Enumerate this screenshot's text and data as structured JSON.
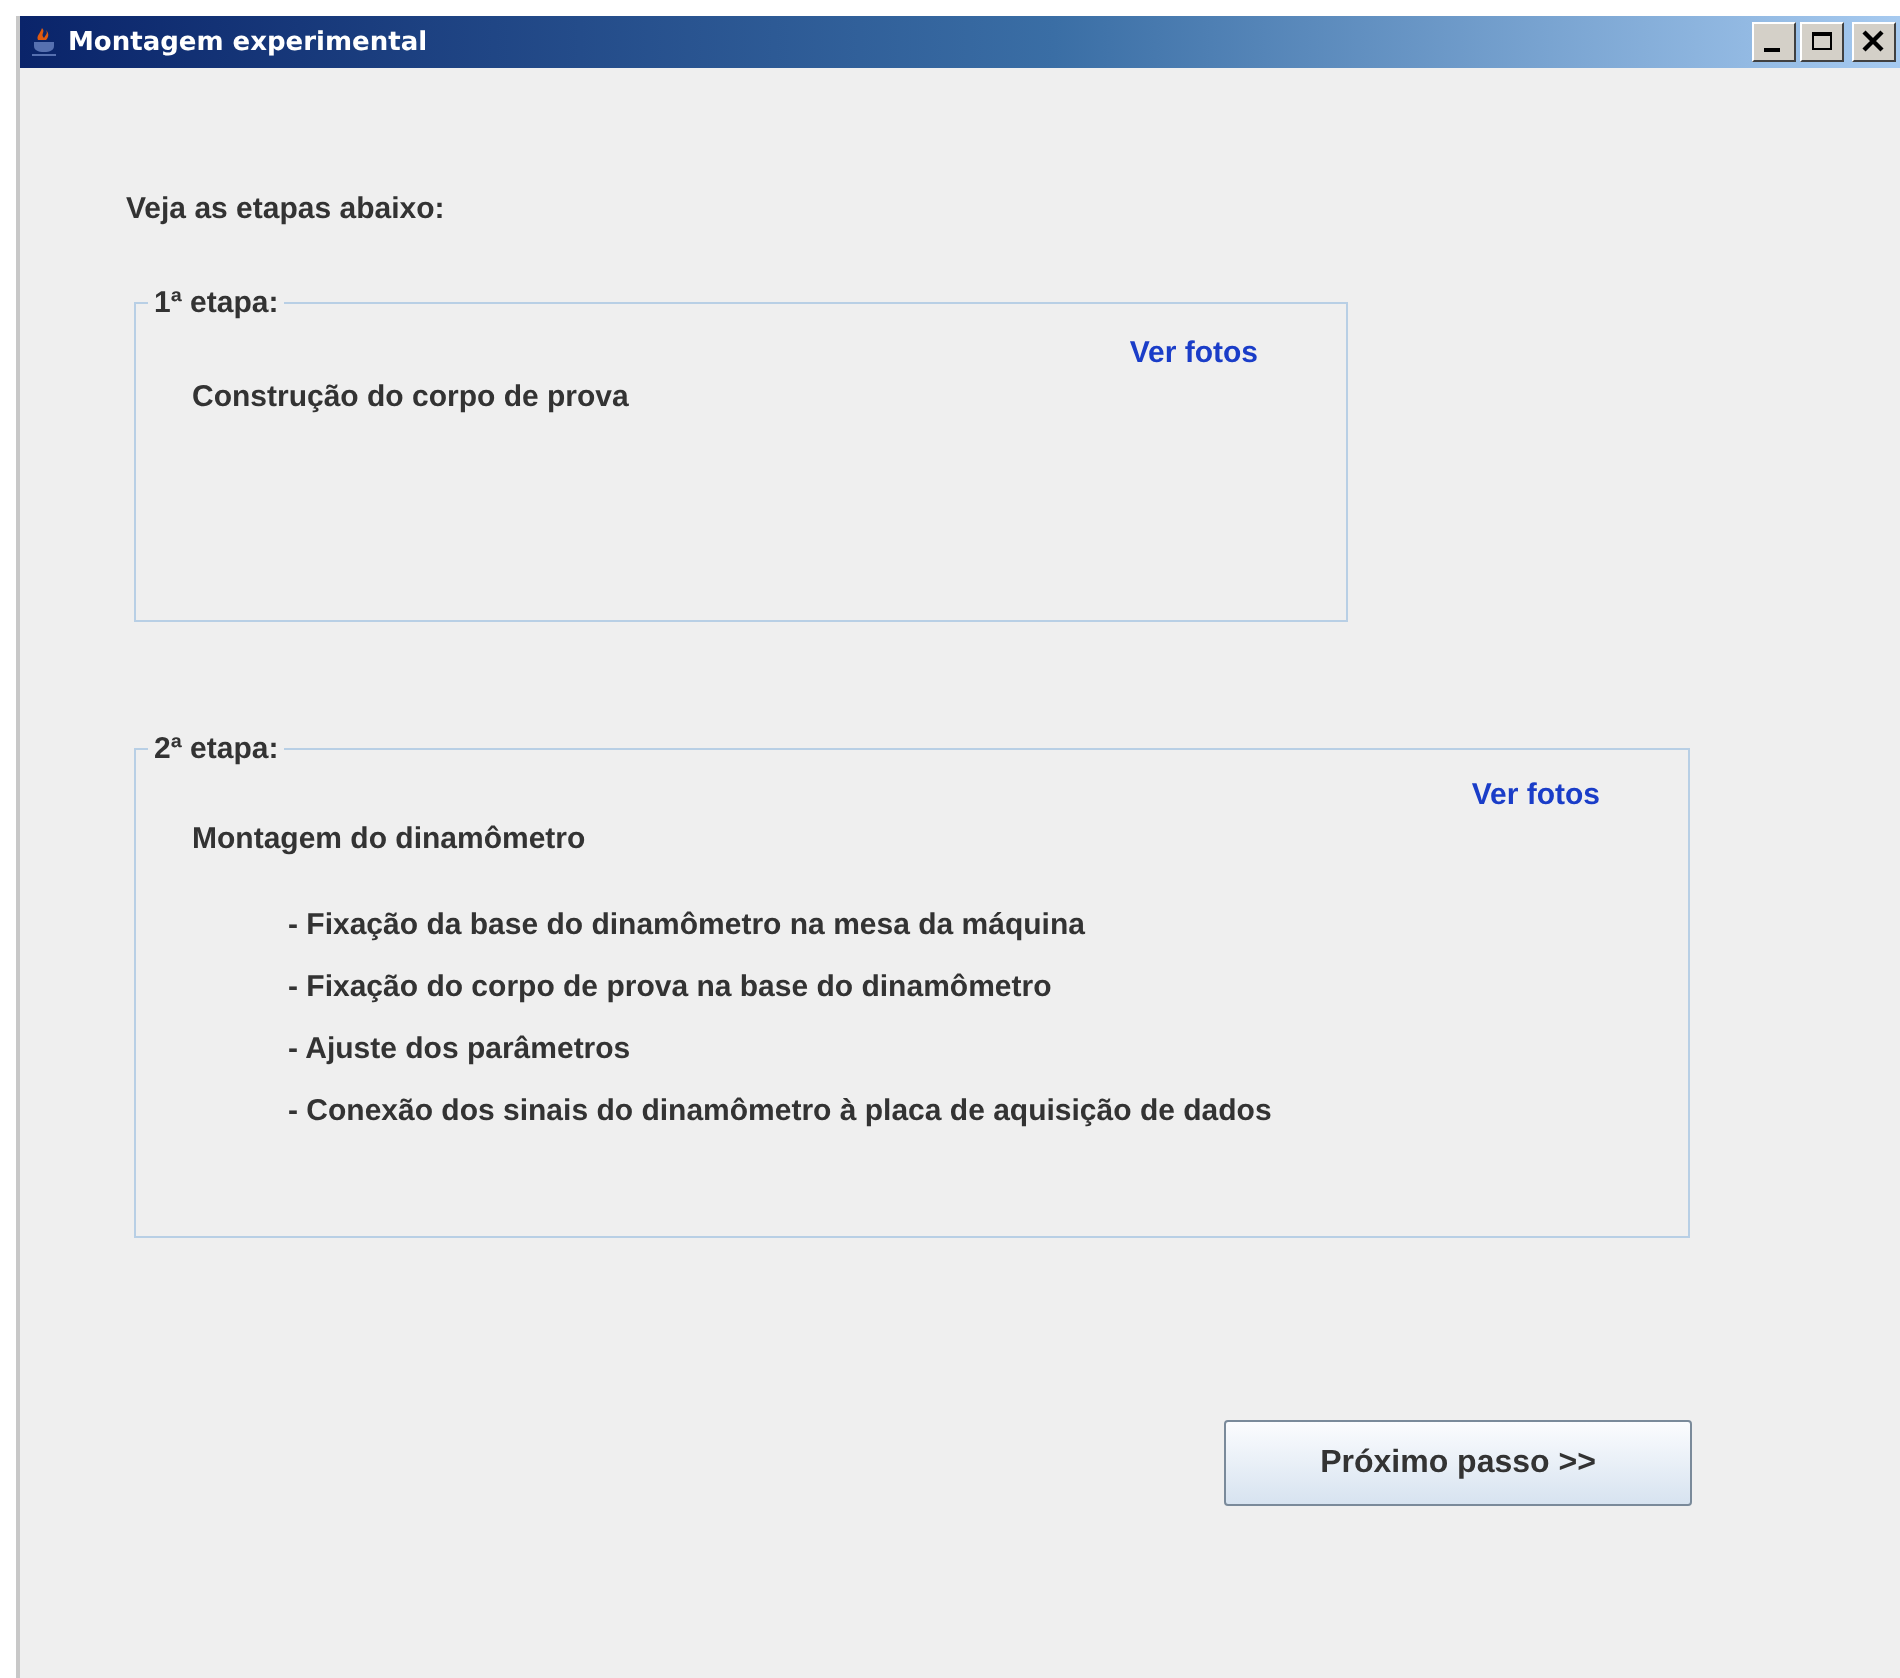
{
  "window": {
    "title": "Montagem experimental"
  },
  "intro": "Veja as etapas abaixo:",
  "stages": [
    {
      "legend": "1ª etapa:",
      "link": "Ver fotos",
      "title": "Construção do corpo de prova"
    },
    {
      "legend": "2ª etapa:",
      "link": "Ver fotos",
      "title": "Montagem do dinamômetro",
      "steps": [
        "- Fixação da base do dinamômetro na mesa da máquina",
        "- Fixação do corpo de prova na base do dinamômetro",
        "- Ajuste dos parâmetros",
        "- Conexão dos sinais do dinamômetro à placa de aquisição de dados"
      ]
    }
  ],
  "next_button": "Próximo passo >>"
}
